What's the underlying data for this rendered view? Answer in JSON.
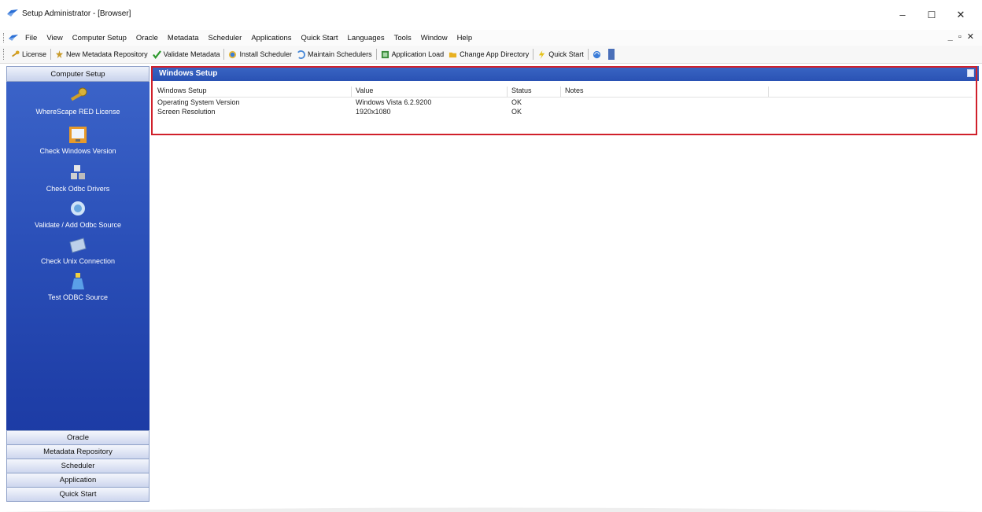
{
  "window": {
    "title": "Setup Administrator - [Browser]",
    "controls": {
      "minimize": "–",
      "maximize": "☐",
      "close": "✕"
    }
  },
  "menubar": {
    "items": [
      "File",
      "View",
      "Computer Setup",
      "Oracle",
      "Metadata",
      "Scheduler",
      "Applications",
      "Quick Start",
      "Languages",
      "Tools",
      "Window",
      "Help"
    ],
    "mdi_controls": "_ ▫ ✕"
  },
  "toolbar": {
    "items": [
      {
        "label": "License",
        "icon": "key-icon"
      },
      {
        "label": "New Metadata Repository",
        "icon": "new-repository-icon"
      },
      {
        "label": "Validate Metadata",
        "icon": "checkmark-icon"
      },
      {
        "label": "Install Scheduler",
        "icon": "scheduler-icon"
      },
      {
        "label": "Maintain Schedulers",
        "icon": "maintain-icon"
      },
      {
        "label": "Application Load",
        "icon": "application-load-icon"
      },
      {
        "label": "Change App Directory",
        "icon": "folder-icon"
      },
      {
        "label": "Quick Start",
        "icon": "lightning-icon"
      }
    ]
  },
  "sidebar": {
    "header": "Computer Setup",
    "items": [
      {
        "label": "WhereScape RED License",
        "icon": "key-icon"
      },
      {
        "label": "Check Windows Version",
        "icon": "windows-monitor-icon"
      },
      {
        "label": "Check Odbc Drivers",
        "icon": "odbc-drivers-icon"
      },
      {
        "label": "Validate / Add Odbc Source",
        "icon": "odbc-source-icon"
      },
      {
        "label": "Check Unix Connection",
        "icon": "unix-connection-icon"
      },
      {
        "label": "Test ODBC Source",
        "icon": "test-flask-icon"
      }
    ],
    "sections": [
      "Oracle",
      "Metadata Repository",
      "Scheduler",
      "Application",
      "Quick Start"
    ]
  },
  "panel": {
    "title": "Windows Setup",
    "columns": [
      "Windows Setup",
      "Value",
      "Status",
      "Notes"
    ],
    "rows": [
      [
        "Operating System Version",
        "Windows Vista 6.2.9200",
        "OK",
        ""
      ],
      [
        "Screen Resolution",
        "1920x1080",
        "OK",
        ""
      ]
    ]
  },
  "colors": {
    "sidebar_blue": "#2a4fb8",
    "header_blue": "#2f5abd",
    "highlight_red": "#d0202b"
  }
}
